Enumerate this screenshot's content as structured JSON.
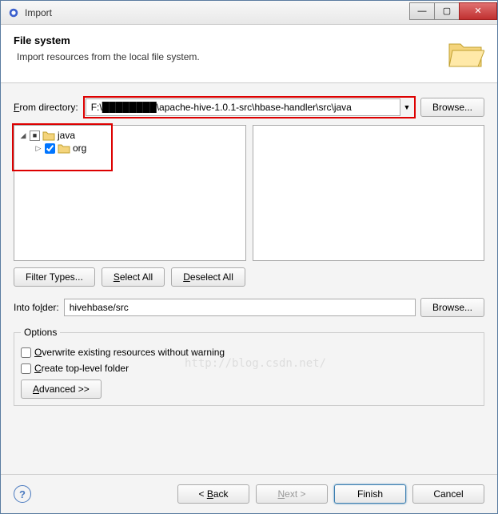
{
  "window": {
    "title": "Import"
  },
  "header": {
    "title": "File system",
    "description": "Import resources from the local file system."
  },
  "from_directory": {
    "label": "From directory:",
    "value": "F:\\████████\\apache-hive-1.0.1-src\\hbase-handler\\src\\java",
    "browse": "Browse..."
  },
  "tree": {
    "items": [
      {
        "label": "java",
        "checked": "partial",
        "expanded": true,
        "level": 0
      },
      {
        "label": "org",
        "checked": true,
        "expanded": false,
        "level": 1
      }
    ]
  },
  "buttons": {
    "filter_types": "Filter Types...",
    "select_all": "Select All",
    "deselect_all": "Deselect All"
  },
  "into_folder": {
    "label": "Into folder:",
    "value": "hivehbase/src",
    "browse": "Browse..."
  },
  "options": {
    "legend": "Options",
    "overwrite": "Overwrite existing resources without warning",
    "create_top": "Create top-level folder",
    "advanced": "Advanced >>"
  },
  "footer": {
    "back": "< Back",
    "next": "Next >",
    "finish": "Finish",
    "cancel": "Cancel"
  },
  "watermark": "http://blog.csdn.net/"
}
